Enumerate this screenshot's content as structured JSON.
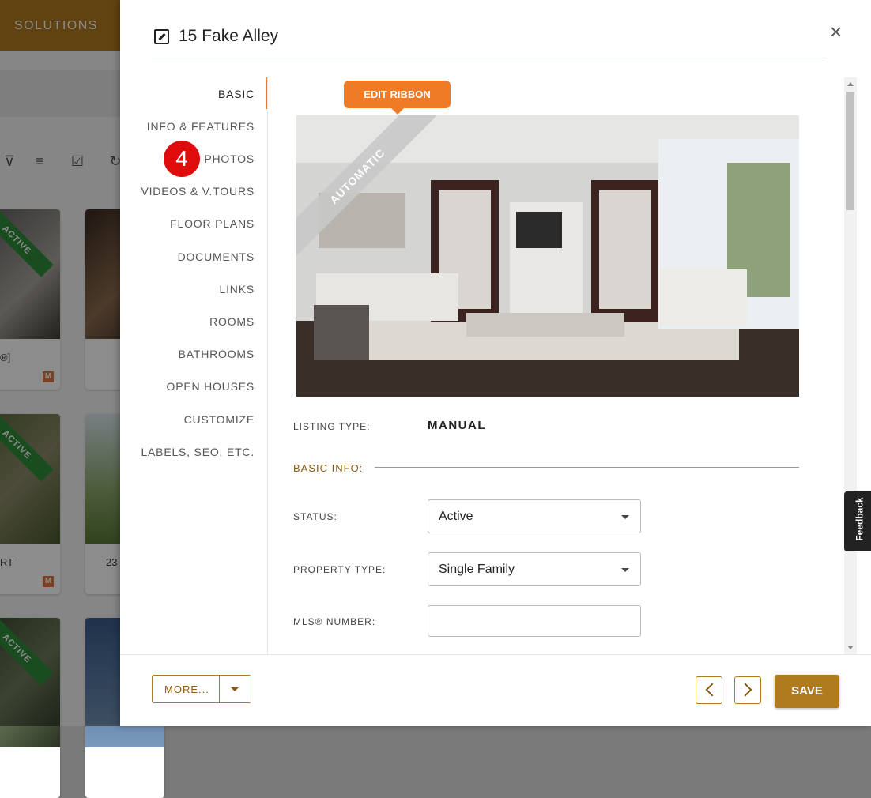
{
  "background": {
    "topbar_label": "SOLUTIONS",
    "cards": [
      {
        "badge": "ACTIVE",
        "text": "®]",
        "m": "M"
      },
      {
        "badge": "",
        "text": "",
        "m": ""
      },
      {
        "badge": "ACTIVE",
        "text": "RT",
        "m": "M"
      },
      {
        "badge": "",
        "text": "23",
        "m": ""
      },
      {
        "badge": "ACTIVE",
        "text": "",
        "m": ""
      },
      {
        "badge": "",
        "text": "",
        "m": ""
      }
    ]
  },
  "modal": {
    "title": "15 Fake Alley",
    "close_icon": "×",
    "nav": [
      {
        "label": "BASIC",
        "active": true
      },
      {
        "label": "INFO & FEATURES"
      },
      {
        "label": "PHOTOS"
      },
      {
        "label": "VIDEOS & V.TOURS"
      },
      {
        "label": "FLOOR PLANS"
      },
      {
        "label": "DOCUMENTS"
      },
      {
        "label": "LINKS"
      },
      {
        "label": "ROOMS"
      },
      {
        "label": "BATHROOMS"
      },
      {
        "label": "OPEN HOUSES"
      },
      {
        "label": "CUSTOMIZE"
      },
      {
        "label": "LABELS, SEO, ETC."
      }
    ],
    "step_badge": "4",
    "edit_ribbon_label": "EDIT RIBBON",
    "photo_ribbon": "AUTOMATIC",
    "listing_type_label": "LISTING TYPE:",
    "listing_type_value": "MANUAL",
    "basic_info_label": "BASIC INFO:",
    "status_label": "STATUS:",
    "status_value": "Active",
    "property_type_label": "PROPERTY TYPE:",
    "property_type_value": "Single Family",
    "mls_label": "MLS® NUMBER:",
    "mls_value": ""
  },
  "footer": {
    "more_label": "MORE...",
    "save_label": "SAVE"
  },
  "feedback_label": "Feedback",
  "colors": {
    "accent": "#b07a1e",
    "orange": "#f07b26",
    "badge_red": "#e00b0b"
  }
}
